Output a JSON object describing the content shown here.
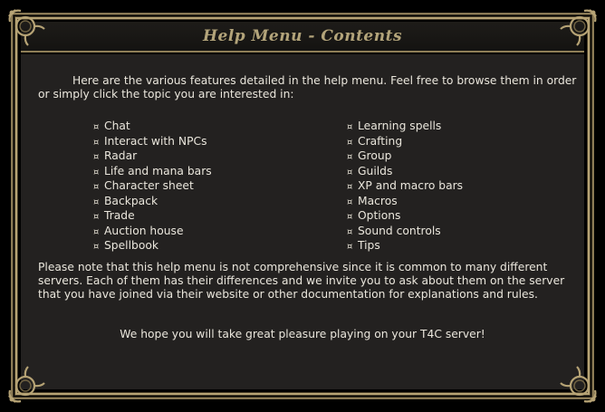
{
  "window": {
    "title": "Help Menu - Contents"
  },
  "content": {
    "intro": "Here are the various features detailed in the help menu. Feel free to browse them in order or simply click the topic you are interested in:",
    "topics_left": [
      "Chat",
      "Interact with NPCs",
      "Radar",
      "Life and mana bars",
      "Character sheet",
      "Backpack",
      "Trade",
      "Auction house",
      "Spellbook"
    ],
    "topics_right": [
      "Learning spells",
      "Crafting",
      "Group",
      "Guilds",
      "XP and macro bars",
      "Macros",
      "Options",
      "Sound controls",
      "Tips"
    ],
    "note": "Please note that this help menu is not comprehensive since it is common to many different servers. Each of them has their differences and we invite you to ask about them on the server that you have joined via their website or other documentation for explanations and rules.",
    "closing": "We hope you will take great pleasure playing on your T4C server!"
  },
  "icons": {
    "bullet": "¤",
    "corner": "ornate-corner-ring-icon"
  },
  "colors": {
    "frame_gold": "#b6a375",
    "title_text": "#b3a47a",
    "panel_bg": "#232120",
    "body_text": "#eae6dc"
  }
}
